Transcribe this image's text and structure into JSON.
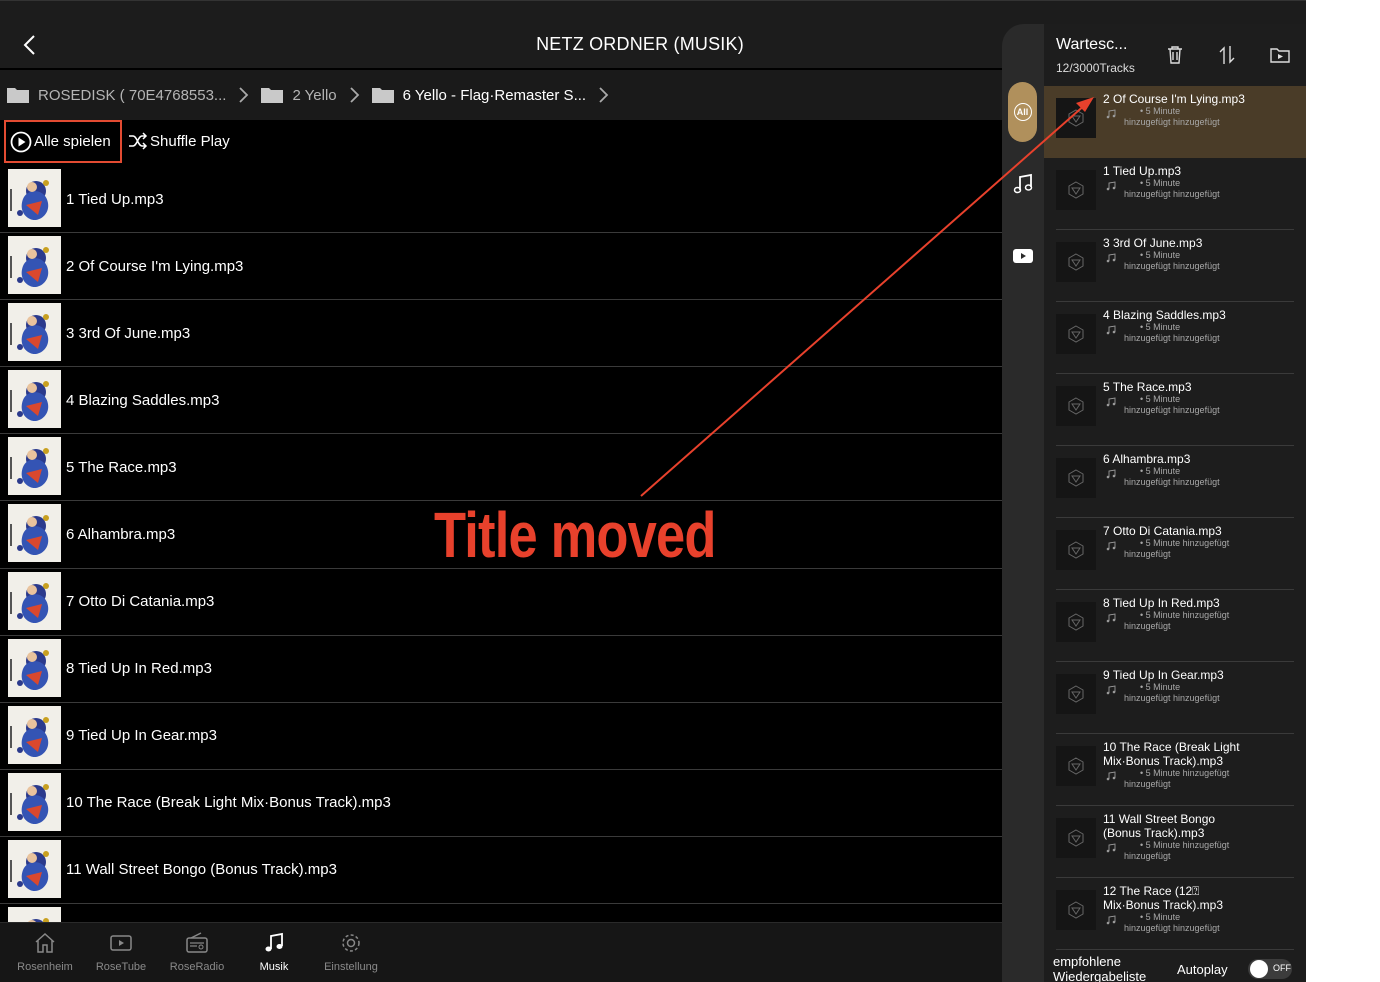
{
  "header": {
    "title": "NETZ ORDNER (MUSIK)"
  },
  "breadcrumb": [
    {
      "label": "ROSEDISK ( 70E4768553..."
    },
    {
      "label": "2 Yello"
    },
    {
      "label": "6 Yello - Flag·Remaster S..."
    }
  ],
  "actions": {
    "play_all": "Alle spielen",
    "shuffle": "Shuffle Play"
  },
  "tracks": [
    "1 Tied Up.mp3",
    "2 Of Course I'm Lying.mp3",
    "3 3rd Of June.mp3",
    "4 Blazing Saddles.mp3",
    "5 The Race.mp3",
    "6 Alhambra.mp3",
    "7 Otto Di Catania.mp3",
    "8 Tied Up In Red.mp3",
    "9 Tied Up In Gear.mp3",
    "10 The Race (Break Light Mix·Bonus Track).mp3",
    "11 Wall Street Bongo (Bonus Track).mp3"
  ],
  "bottom_nav": [
    {
      "label": "Rosenheim",
      "icon": "home-icon"
    },
    {
      "label": "RoseTube",
      "icon": "video-icon"
    },
    {
      "label": "RoseRadio",
      "icon": "radio-icon"
    },
    {
      "label": "Musik",
      "icon": "music-note-icon",
      "active": true
    },
    {
      "label": "Einstellung",
      "icon": "gear-icon"
    }
  ],
  "queue": {
    "title": "Wartesc...",
    "count": "12/3000Tracks",
    "rail_all": "All",
    "items": [
      {
        "name": "2 Of Course I'm Lying.mp3",
        "duration": "• 5 Minute",
        "added": "hinzugefügt hinzugefügt",
        "active": true
      },
      {
        "name": "1 Tied Up.mp3",
        "duration": "• 5 Minute",
        "added": "hinzugefügt hinzugefügt"
      },
      {
        "name": "3 3rd Of June.mp3",
        "duration": "• 5 Minute",
        "added": "hinzugefügt hinzugefügt"
      },
      {
        "name": "4 Blazing Saddles.mp3",
        "duration": "• 5 Minute",
        "added": "hinzugefügt hinzugefügt"
      },
      {
        "name": "5 The Race.mp3",
        "duration": "• 5 Minute",
        "added": "hinzugefügt hinzugefügt"
      },
      {
        "name": "6 Alhambra.mp3",
        "duration": "• 5 Minute",
        "added": "hinzugefügt hinzugefügt"
      },
      {
        "name": "7 Otto Di Catania.mp3",
        "duration": "• 5 Minute hinzugefügt",
        "added": "hinzugefügt"
      },
      {
        "name": "8 Tied Up In Red.mp3",
        "duration": "• 5 Minute hinzugefügt",
        "added": "hinzugefügt"
      },
      {
        "name": "9 Tied Up In Gear.mp3",
        "duration": "• 5 Minute",
        "added": "hinzugefügt hinzugefügt"
      },
      {
        "name": "10 The Race (Break Light Mix·Bonus Track).mp3",
        "duration": "• 5 Minute hinzugefügt",
        "added": "hinzugefügt"
      },
      {
        "name": "11 Wall Street Bongo (Bonus Track).mp3",
        "duration": "• 5 Minute hinzugefügt",
        "added": "hinzugefügt"
      },
      {
        "name": "12 The Race (12⍰ Mix·Bonus Track).mp3",
        "duration": "• 5 Minute",
        "added": "hinzugefügt hinzugefügt"
      }
    ],
    "footer": {
      "recommended": "empfohlene Wiedergabeliste",
      "autoplay": "Autoplay",
      "toggle": "OFF"
    }
  },
  "annotation": {
    "text": "Title moved",
    "color": "#e8412c"
  },
  "colors": {
    "accent": "#b0905c",
    "highlight": "#e34b32",
    "active_row": "#4a3c28"
  }
}
